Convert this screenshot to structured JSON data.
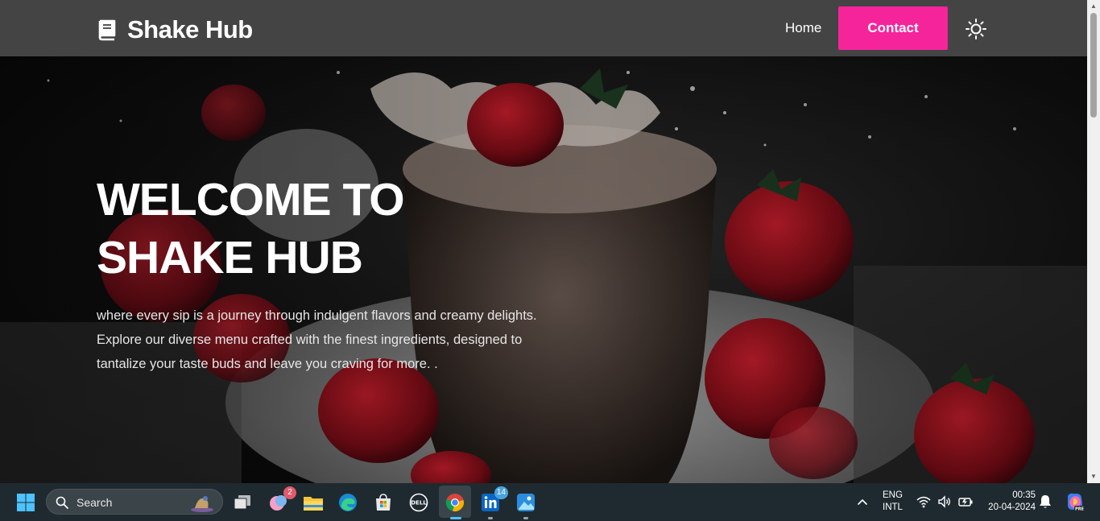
{
  "navbar": {
    "brand_name": "Shake Hub",
    "brand_icon": "book-icon",
    "home_label": "Home",
    "contact_label": "Contact",
    "theme_icon": "sun-icon",
    "accent_color": "#f6249b",
    "background_color": "#444444"
  },
  "hero": {
    "title_line1": "WELCOME TO",
    "title_line2": "SHAKE HUB",
    "description": "where every sip is a journey through indulgent flavors and creamy delights. Explore our diverse menu crafted with the finest ingredients, designed to tantalize your taste buds and leave you craving for more. .",
    "background_description_icon": "strawberry-milkshake-photo"
  },
  "taskbar": {
    "search_placeholder": "Search",
    "apps": [
      {
        "name": "windows-start-icon"
      },
      {
        "name": "task-view-icon"
      },
      {
        "name": "widgets-icon",
        "badge": "2"
      },
      {
        "name": "file-explorer-icon"
      },
      {
        "name": "edge-icon"
      },
      {
        "name": "microsoft-store-icon"
      },
      {
        "name": "dell-icon"
      },
      {
        "name": "chrome-icon"
      },
      {
        "name": "linkedin-icon",
        "badge": "14"
      },
      {
        "name": "photos-icon"
      }
    ],
    "language_line1": "ENG",
    "language_line2": "INTL",
    "time": "00:35",
    "date": "20-04-2024"
  }
}
